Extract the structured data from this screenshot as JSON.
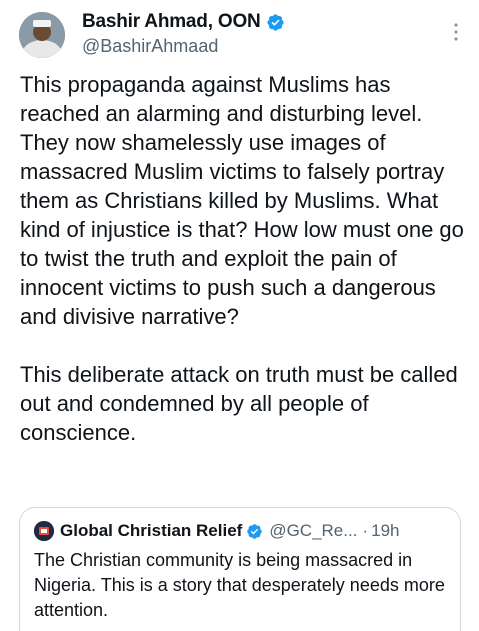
{
  "author": {
    "display_name": "Bashir Ahmad, OON",
    "handle": "@BashirAhmaad",
    "verified_icon": "verified-badge-icon",
    "avatar": "avatar"
  },
  "tweet": {
    "text": "This propaganda against Muslims has reached an alarming and disturbing level. They now shamelessly use images of massacred Muslim victims to falsely portray them as Christians killed by Muslims. What kind of injustice is that? How low must one go to twist the truth and exploit the pain of innocent victims to push such a dangerous and divisive narrative?\n\nThis deliberate attack on truth must be called out and condemned by all people of conscience."
  },
  "quoted_tweet": {
    "display_name": "Global Christian Relief",
    "handle": "@GC_Re...",
    "separator": "·",
    "time": "19h",
    "text": "The Christian community is being massacred in Nigeria. This is a story that desperately needs more attention."
  },
  "colors": {
    "primary_text": "#0f1419",
    "secondary_text": "#536471",
    "verified_blue": "#1d9bf0",
    "border": "#cfd9de"
  }
}
